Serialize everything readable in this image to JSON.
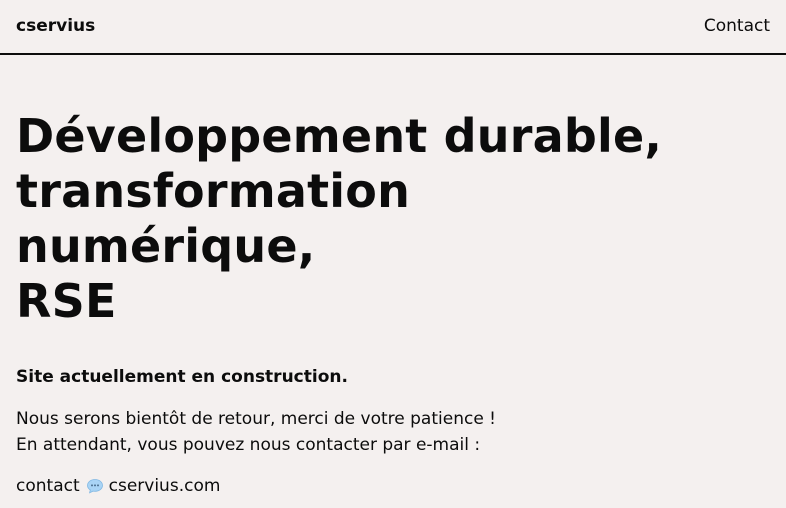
{
  "header": {
    "brand": "cservius",
    "nav_contact": "Contact"
  },
  "hero": {
    "headline_lines": [
      "Développement durable,",
      "transformation",
      "numérique,",
      "RSE"
    ]
  },
  "content": {
    "construction_notice": "Site actuellement en construction.",
    "message_lines": [
      "Nous serons bientôt de retour, merci de votre patience !",
      "En attendant, vous pouvez nous contacter par e-mail :"
    ],
    "email": {
      "user": "contact",
      "domain": "cservius.com",
      "separator_icon": "speech-bubble-icon"
    }
  },
  "colors": {
    "background": "#f4f0ef",
    "text": "#0c0c0c",
    "icon_bubble": "#a9d4f5"
  }
}
